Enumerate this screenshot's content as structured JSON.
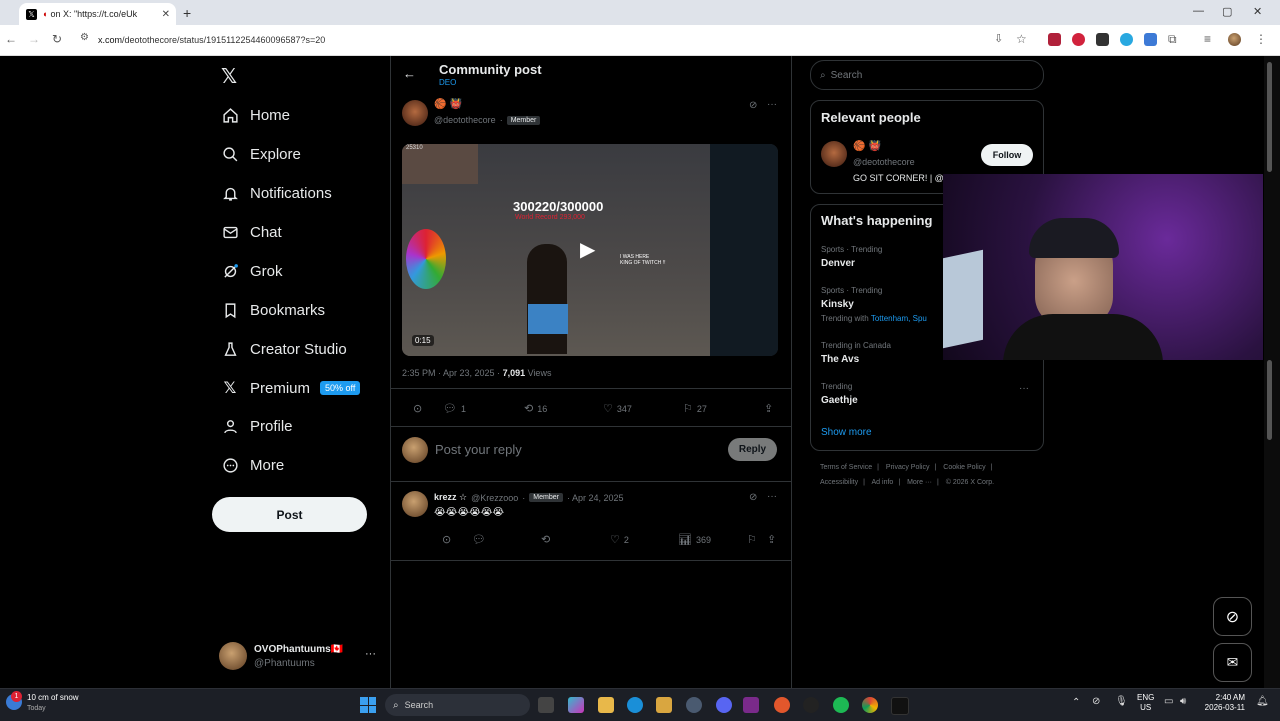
{
  "browser": {
    "tab_title": "on X: \"https://t.co/eUk",
    "url_host": "x.com",
    "url_path": "/deotothecore/status/1915112254460096587?s=20"
  },
  "nav": {
    "items": [
      {
        "label": "Home",
        "icon": "home-icon"
      },
      {
        "label": "Explore",
        "icon": "search-icon"
      },
      {
        "label": "Notifications",
        "icon": "bell-icon"
      },
      {
        "label": "Chat",
        "icon": "mail-icon"
      },
      {
        "label": "Grok",
        "icon": "grok-icon"
      },
      {
        "label": "Bookmarks",
        "icon": "bookmark-icon"
      },
      {
        "label": "Creator Studio",
        "icon": "flask-icon"
      },
      {
        "label": "Premium",
        "icon": "x-icon"
      },
      {
        "label": "Profile",
        "icon": "person-icon"
      },
      {
        "label": "More",
        "icon": "more-circle-icon"
      }
    ],
    "premium_badge": "50% off",
    "post_button": "Post"
  },
  "account": {
    "name": "OVOPhantuums🇨🇦",
    "handle": "@Phantuums",
    "more": "···"
  },
  "header": {
    "title": "Community post",
    "community": "DEO"
  },
  "post": {
    "handle": "@deotothecore",
    "badge": "Member",
    "video_overlay_text": "300220/300000",
    "video_sub_text": "World Record 293,000",
    "video_overlay_right": "I WAS HERE\nKING OF TWITCH !!",
    "video_count_corner": "25310",
    "video_duration": "0:15",
    "time": "2:35 PM · Apr 23, 2025 · ",
    "views_count": "7,091",
    "views_label": " Views",
    "replies": "1",
    "reposts": "16",
    "likes": "347",
    "bookmarks": "27"
  },
  "reply_box": {
    "placeholder": "Post your reply",
    "button": "Reply"
  },
  "reply": {
    "name": "krezz ☆",
    "handle": "@Krezzooo",
    "badge": "Member",
    "date": "· Apr 24, 2025",
    "text": "😭😭😭😭😭😭",
    "likes": "2",
    "views": "369"
  },
  "search": {
    "placeholder": "Search"
  },
  "relevant": {
    "heading": "Relevant people",
    "handle": "@deotothecore",
    "bio": "GO SIT CORNER! | @",
    "follow": "Follow"
  },
  "happening": {
    "heading": "What's happening",
    "trends": [
      {
        "meta": "Sports · Trending",
        "name": "Denver"
      },
      {
        "meta": "Sports · Trending",
        "name": "Kinsky",
        "extra_prefix": "Trending with ",
        "extra_link": "Tottenham, Spu"
      },
      {
        "meta": "Trending in Canada",
        "name": "The Avs"
      },
      {
        "meta": "Trending",
        "name": "Gaethje"
      }
    ],
    "show_more": "Show more"
  },
  "footer_links": {
    "line1": [
      "Terms of Service",
      "Privacy Policy",
      "Cookie Policy"
    ],
    "line2": [
      "Accessibility",
      "Ad info",
      "More ···",
      "© 2026 X Corp."
    ]
  },
  "taskbar": {
    "weather_line1": "10 cm of snow",
    "weather_line2": "Today",
    "weather_badge": "1",
    "search": "Search",
    "lang1": "ENG",
    "lang2": "US",
    "time": "2:40 AM",
    "date": "2026-03-11"
  },
  "colors": {
    "accent": "#1d9bf0",
    "background": "#000000",
    "text": "#e7e9ea",
    "muted": "#71767b",
    "border": "#2f3336"
  }
}
